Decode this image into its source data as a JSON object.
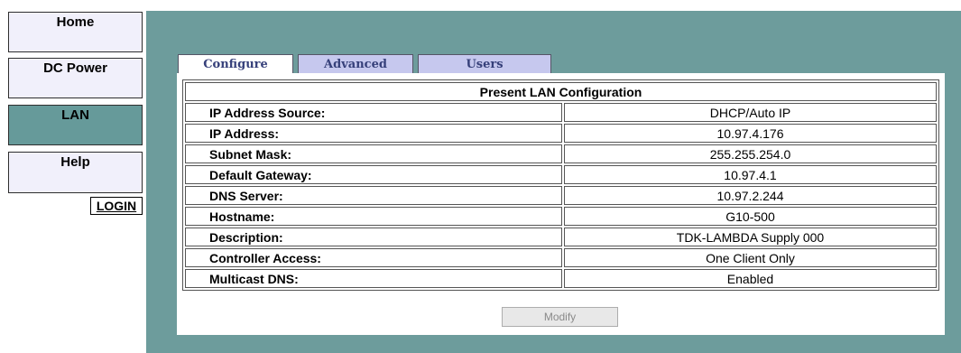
{
  "nav": {
    "home": "Home",
    "dc_power": "DC Power",
    "lan": "LAN",
    "help": "Help",
    "login": "LOGIN"
  },
  "tabs": [
    "Configure",
    "Advanced",
    "Users"
  ],
  "table": {
    "title": "Present LAN Configuration",
    "rows": [
      {
        "label": "IP Address Source:",
        "value": "DHCP/Auto IP"
      },
      {
        "label": "IP Address:",
        "value": "10.97.4.176"
      },
      {
        "label": "Subnet Mask:",
        "value": "255.255.254.0"
      },
      {
        "label": "Default Gateway:",
        "value": "10.97.4.1"
      },
      {
        "label": "DNS Server:",
        "value": "10.97.2.244"
      },
      {
        "label": "Hostname:",
        "value": "G10-500"
      },
      {
        "label": "Description:",
        "value": "TDK-LAMBDA Supply 000"
      },
      {
        "label": "Controller Access:",
        "value": "One Client Only"
      },
      {
        "label": "Multicast DNS:",
        "value": "Enabled"
      }
    ]
  },
  "modify_label": "Modify",
  "colors": {
    "panel_bg": "#6d9c9c",
    "active_nav": "#669a9a",
    "nav_bg": "#f1f0fb",
    "tab_inactive": "#c6c8ee",
    "tab_text": "#36407a"
  }
}
